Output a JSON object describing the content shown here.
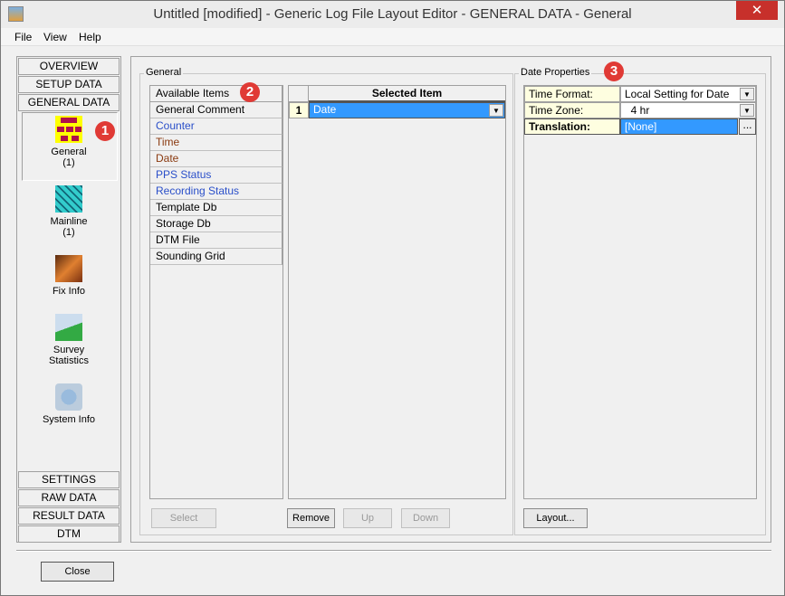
{
  "window": {
    "title": "Untitled [modified] - Generic Log File Layout Editor -  GENERAL DATA -  General",
    "close": "✕"
  },
  "menu": [
    "File",
    "View",
    "Help"
  ],
  "sidebar": {
    "top_tabs": [
      "OVERVIEW",
      "SETUP DATA",
      "GENERAL DATA"
    ],
    "items": [
      {
        "label": "General",
        "count": "(1)"
      },
      {
        "label": "Mainline",
        "count": "(1)"
      },
      {
        "label": "Fix Info",
        "count": ""
      },
      {
        "label": "Survey",
        "count": "Statistics"
      },
      {
        "label": "System Info",
        "count": ""
      }
    ],
    "bottom_tabs": [
      "SETTINGS",
      "RAW DATA",
      "RESULT DATA",
      "DTM"
    ]
  },
  "general": {
    "legend": "General",
    "available_header": "Available Items",
    "available": [
      {
        "label": "General Comment",
        "color": "#000000"
      },
      {
        "label": "Counter",
        "color": "#2a4fc9"
      },
      {
        "label": "Time",
        "color": "#8a3a10"
      },
      {
        "label": "Date",
        "color": "#8a3a10"
      },
      {
        "label": "PPS Status",
        "color": "#2a4fc9"
      },
      {
        "label": "Recording Status",
        "color": "#2a4fc9"
      },
      {
        "label": "Template Db",
        "color": "#000000"
      },
      {
        "label": "Storage Db",
        "color": "#000000"
      },
      {
        "label": "DTM File",
        "color": "#000000"
      },
      {
        "label": "Sounding Grid",
        "color": "#000000"
      }
    ],
    "selected_header": "Selected Item",
    "selected": [
      {
        "num": "1",
        "value": "Date"
      }
    ],
    "buttons": {
      "select": "Select",
      "remove": "Remove",
      "up": "Up",
      "down": "Down"
    }
  },
  "date_properties": {
    "legend": "Date Properties",
    "rows": [
      {
        "label": "Time Format:",
        "value": "Local Setting for Date"
      },
      {
        "label": "Time Zone:",
        "value": "  4 hr"
      },
      {
        "label": "Translation:",
        "value": "[None]"
      }
    ],
    "ellipsis": "...",
    "layout_button": "Layout..."
  },
  "badges": [
    "1",
    "2",
    "3"
  ],
  "close_button": "Close"
}
